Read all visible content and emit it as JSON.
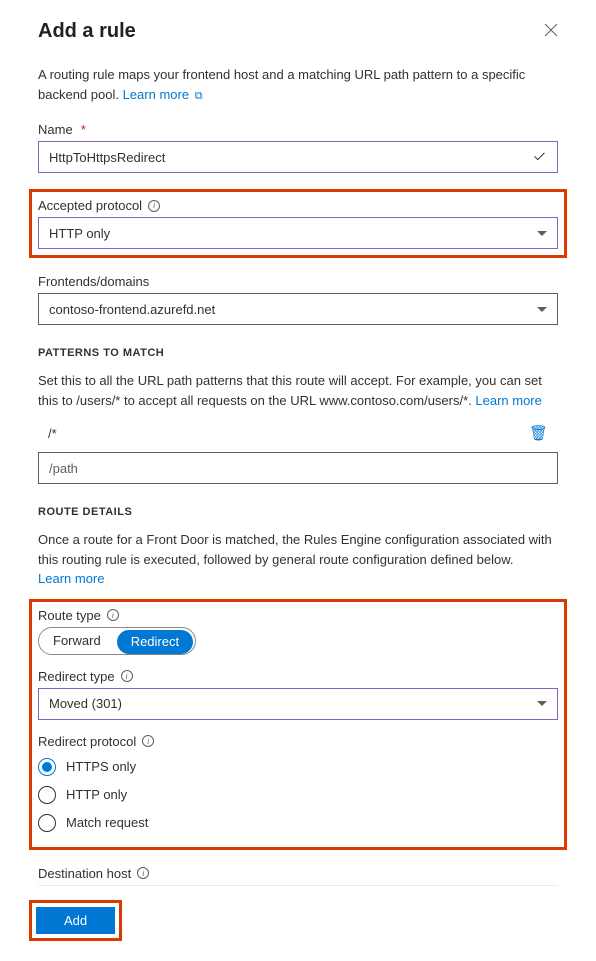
{
  "header": {
    "title": "Add a rule"
  },
  "intro": {
    "text": "A routing rule maps your frontend host and a matching URL path pattern to a specific backend pool. ",
    "link": "Learn more"
  },
  "name": {
    "label": "Name",
    "value": "HttpToHttpsRedirect"
  },
  "protocol": {
    "label": "Accepted protocol",
    "value": "HTTP only"
  },
  "frontends": {
    "label": "Frontends/domains",
    "value": "contoso-frontend.azurefd.net"
  },
  "patterns": {
    "heading": "PATTERNS TO MATCH",
    "help_prefix": "Set this to all the URL path patterns that this route will accept. For example, you can set this to /users/* to accept all requests on the URL www.contoso.com/users/*. ",
    "link": "Learn more",
    "row_value": "/*",
    "placeholder": "/path"
  },
  "route_details": {
    "heading": "ROUTE DETAILS",
    "help_prefix": "Once a route for a Front Door is matched, the Rules Engine configuration associated with this routing rule is executed, followed by general route configuration defined below. ",
    "link": "Learn more"
  },
  "route_type": {
    "label": "Route type",
    "forward": "Forward",
    "redirect": "Redirect"
  },
  "redirect_type": {
    "label": "Redirect type",
    "value": "Moved (301)"
  },
  "redirect_protocol": {
    "label": "Redirect protocol",
    "options": {
      "https": "HTTPS only",
      "http": "HTTP only",
      "match": "Match request"
    }
  },
  "destination": {
    "label": "Destination host"
  },
  "footer": {
    "add": "Add"
  }
}
